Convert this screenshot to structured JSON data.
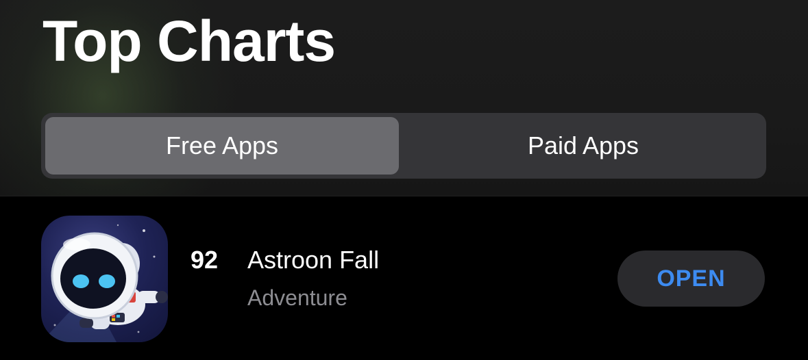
{
  "header": {
    "title": "Top Charts"
  },
  "segments": {
    "free_label": "Free Apps",
    "paid_label": "Paid Apps",
    "selected": "Free Apps"
  },
  "app": {
    "rank": "92",
    "name": "Astroon Fall",
    "category": "Adventure",
    "action_label": "OPEN",
    "icon": "astronaut-app-icon"
  },
  "colors": {
    "accent": "#3d8bf0",
    "background": "#000000",
    "header_background": "#1a1a1a",
    "segment_selected": "#6b6b6f",
    "segment_track": "#353538",
    "button_background": "#2a2a2d",
    "secondary_text": "#8d8d92"
  }
}
